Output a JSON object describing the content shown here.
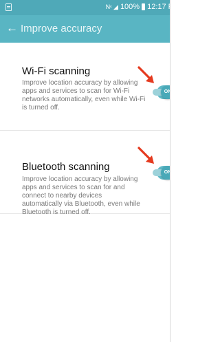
{
  "status_bar": {
    "battery_percent": "100%",
    "time": "12:17 P",
    "signal_text": "N⁴",
    "icons": [
      "notification-icon",
      "wifi-signal-icon",
      "cell-signal-icon",
      "battery-icon"
    ]
  },
  "app_bar": {
    "title": "Improve accuracy",
    "back_icon": "back-arrow-icon",
    "back_glyph": "←"
  },
  "items": [
    {
      "title": "Wi-Fi scanning",
      "description": "Improve location accuracy by allowing apps and services to scan for Wi-Fi networks automatically, even while Wi-Fi is turned off.",
      "toggle_label": "ON",
      "enabled": true
    },
    {
      "title": "Bluetooth scanning",
      "description": "Improve location accuracy by allowing apps and services to scan for and connect to nearby devices automatically via Bluetooth, even while Bluetooth is turned off.",
      "toggle_label": "ON",
      "enabled": true
    }
  ],
  "colors": {
    "status_bar": "#4fa9b8",
    "app_bar": "#59b5c3",
    "toggle_on": "#49a9b8",
    "annotation_arrow": "#e53a1f"
  }
}
